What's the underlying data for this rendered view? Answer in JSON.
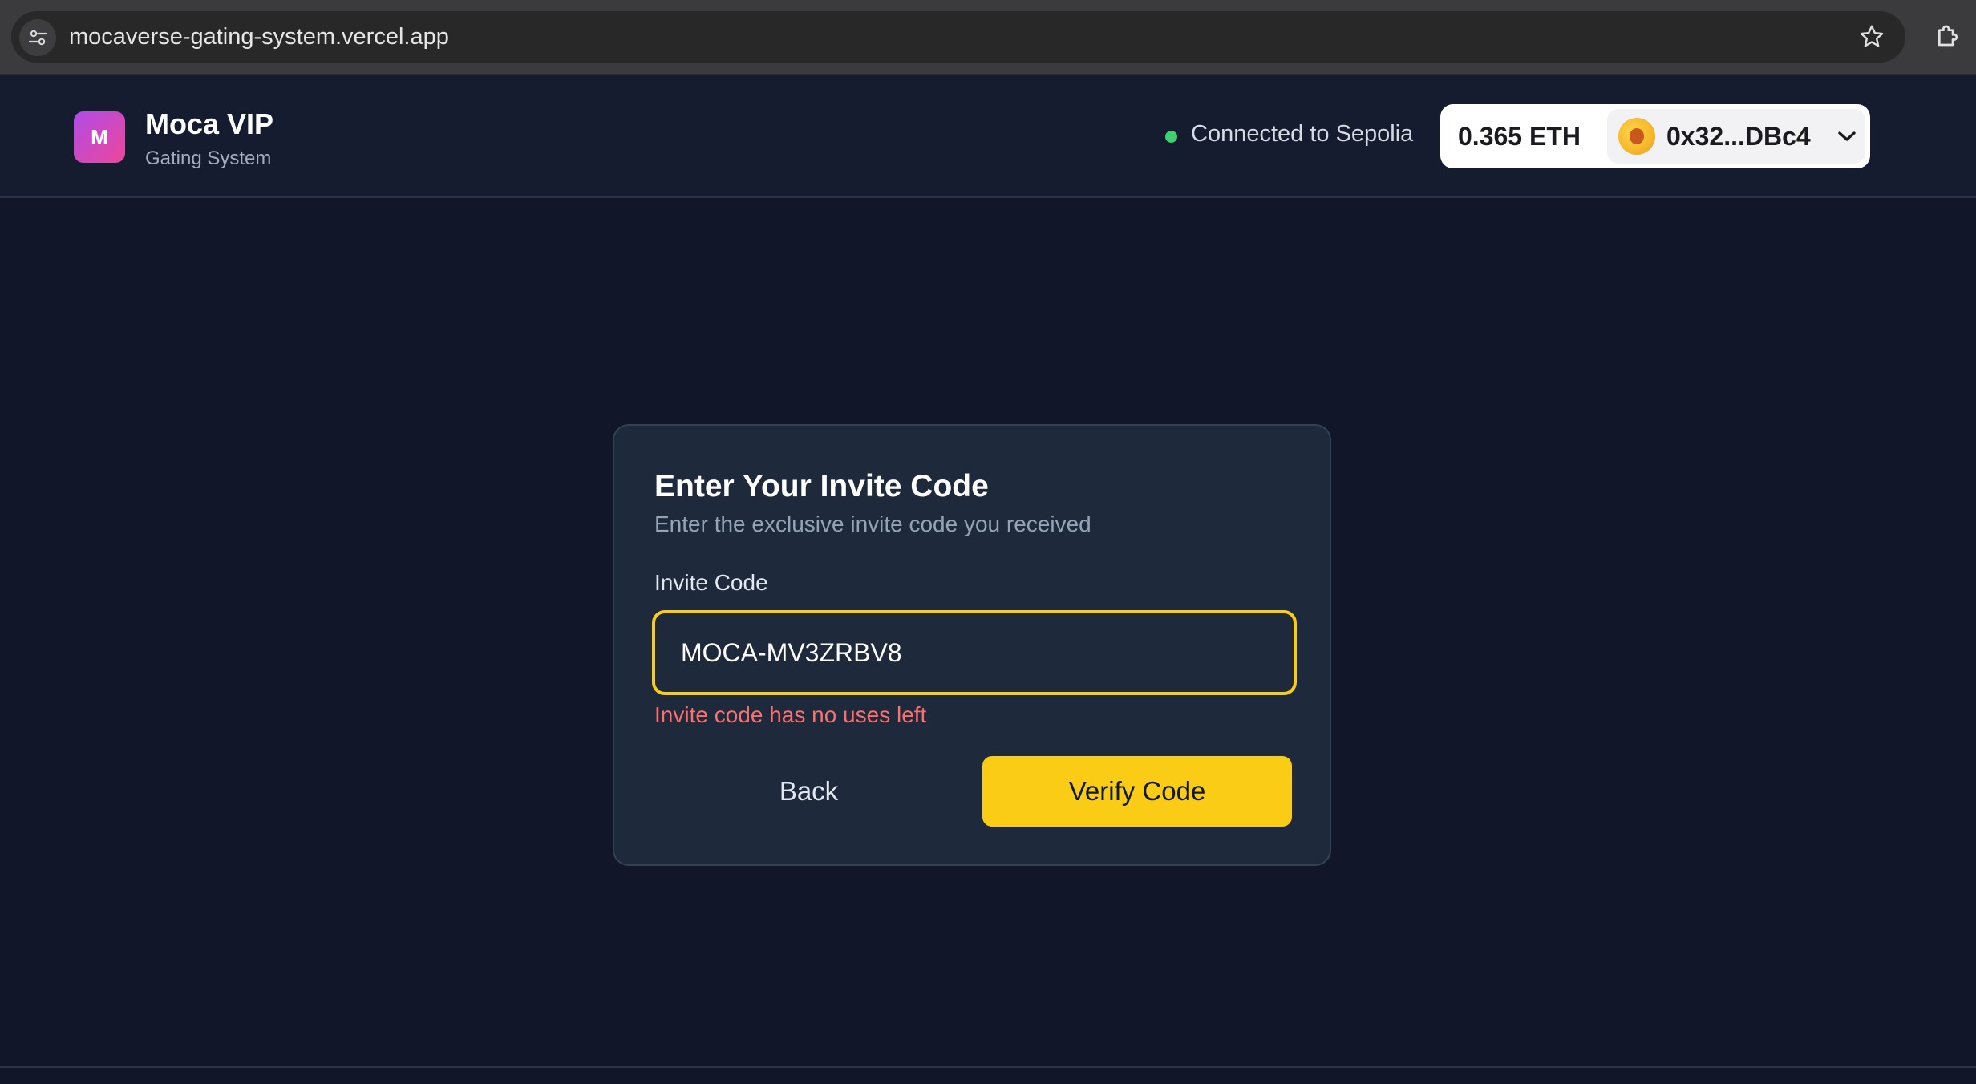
{
  "browser": {
    "url": "mocaverse-gating-system.vercel.app",
    "icons": {
      "site_settings": "tune-icon",
      "bookmark": "star-icon",
      "extensions": "puzzle-icon"
    }
  },
  "header": {
    "logo_letter": "M",
    "title": "Moca VIP",
    "subtitle": "Gating System",
    "network_status": "Connected to Sepolia",
    "status_color": "#3fcf6e",
    "wallet": {
      "balance": "0.365 ETH",
      "address": "0x32...DBc4",
      "icons": {
        "avatar": "avatar-icon",
        "menu": "chevron-down-icon"
      }
    }
  },
  "card": {
    "title": "Enter Your Invite Code",
    "subtitle": "Enter the exclusive invite code you received",
    "field_label": "Invite Code",
    "field_value": "MOCA-MV3ZRBV8",
    "error_message": "Invite code has no uses left",
    "back_label": "Back",
    "verify_label": "Verify Code"
  },
  "colors": {
    "background": "#111729",
    "card": "#1e293b",
    "accent": "#facc15",
    "error": "#f87171",
    "logo_gradient": [
      "#b14ae8",
      "#ec4899"
    ]
  }
}
